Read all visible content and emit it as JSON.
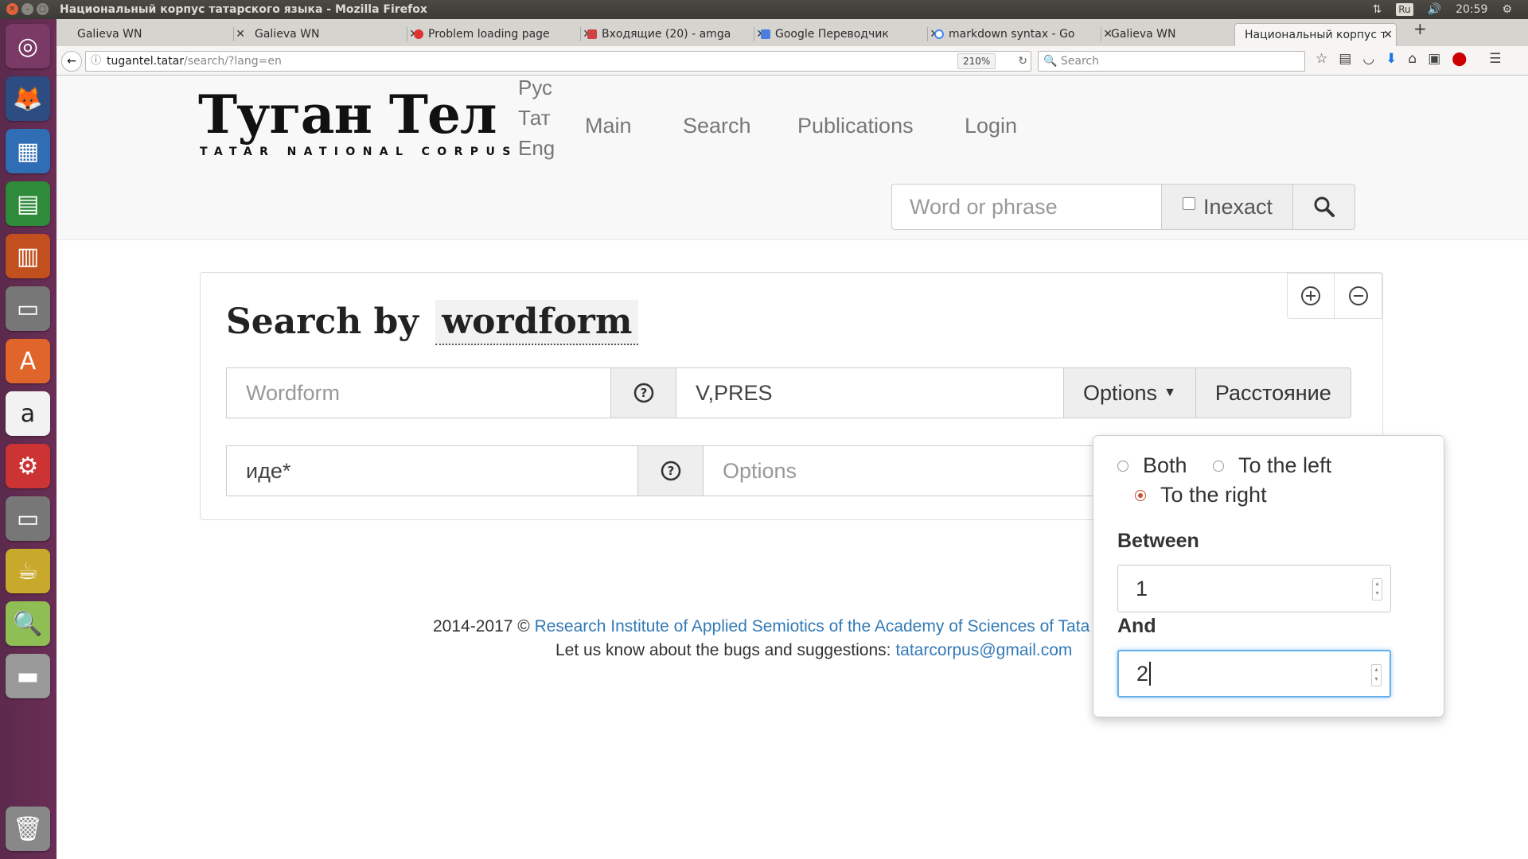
{
  "os": {
    "window_title": "Национальный корпус татарского языка - Mozilla Firefox",
    "keyboard_layout": "Ru",
    "clock": "20:59"
  },
  "launcher": {
    "items": [
      "ubuntu-icon",
      "firefox-icon",
      "image-viewer-icon",
      "spreadsheet-icon",
      "presentation-icon",
      "files-icon",
      "software-center-icon",
      "amazon-icon",
      "settings-icon",
      "files-icon-2",
      "teapot-icon",
      "search-monitor-icon",
      "disk-icon",
      "trash-icon"
    ]
  },
  "browser": {
    "tabs": [
      {
        "label": "Galieva WN"
      },
      {
        "label": "Galieva WN"
      },
      {
        "label": "Problem loading page"
      },
      {
        "label": "Входящие (20) - amga"
      },
      {
        "label": "Google Переводчик"
      },
      {
        "label": "markdown syntax - Go"
      },
      {
        "label": "Galieva WN"
      },
      {
        "label": "Национальный корпус т"
      }
    ],
    "url_host": "tugantel.tatar",
    "url_rest": "/search/?lang=en",
    "zoom": "210%",
    "search_placeholder": "Search"
  },
  "site": {
    "logo_title": "Туган Тел",
    "logo_subtitle": "TATAR NATIONAL CORPUS",
    "langs": [
      "Рус",
      "Тат",
      "Eng"
    ],
    "nav": [
      "Main",
      "Search",
      "Publications",
      "Login"
    ],
    "header_search": {
      "placeholder": "Word or phrase",
      "inexact_label": "Inexact"
    }
  },
  "search": {
    "title_prefix": "Search by",
    "mode": "wordform",
    "row1": {
      "wordform_placeholder": "Wordform",
      "tags_value": "V,PRES",
      "options_label": "Options",
      "distance_label": "Расстояние"
    },
    "row2": {
      "wordform_value": "иде*",
      "tags_placeholder": "Options"
    }
  },
  "footer": {
    "copyright": "2014-2017 © ",
    "institute_link": "Research Institute of Applied Semiotics of the Academy of Sciences of Tata",
    "bugs_text": "Let us know about the bugs and suggestions: ",
    "email_link": "tatarcorpus@gmail.com"
  },
  "popover": {
    "options": [
      {
        "label": "Both",
        "checked": false
      },
      {
        "label": "To the left",
        "checked": false
      },
      {
        "label": "To the right",
        "checked": true
      }
    ],
    "between_label": "Between",
    "between_value": "1",
    "and_label": "And",
    "and_value": "2"
  },
  "colors": {
    "accent_radio": "#c8502d",
    "link": "#337ab7",
    "focus": "#66afe9"
  }
}
